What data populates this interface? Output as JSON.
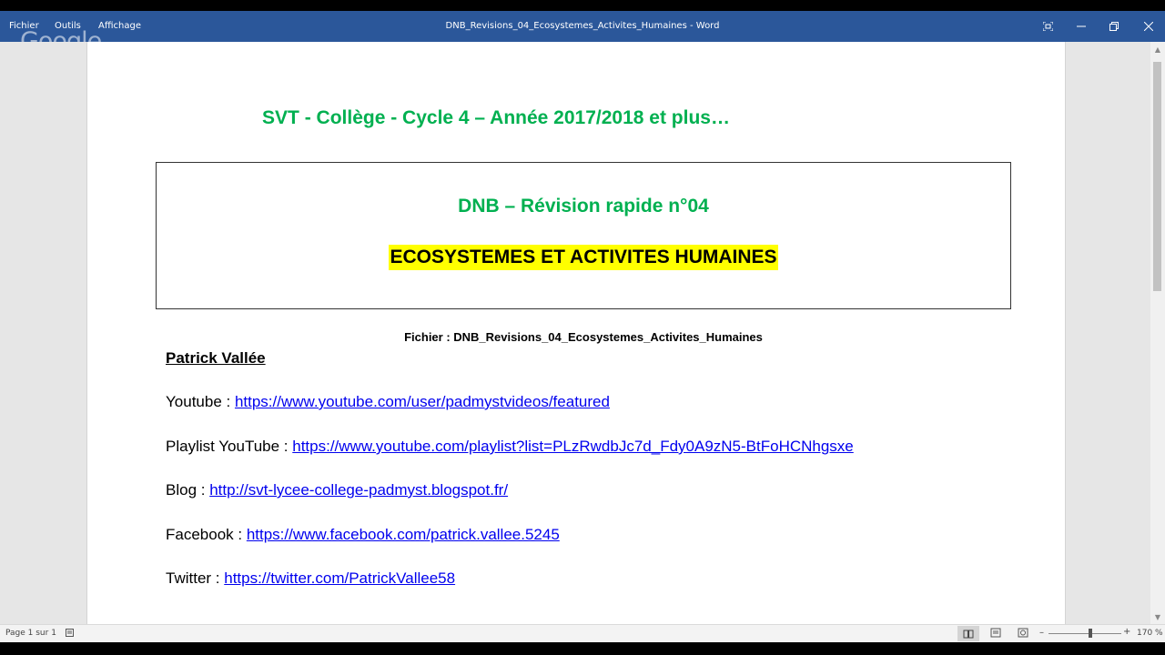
{
  "titlebar": {
    "menus": [
      "Fichier",
      "Outils",
      "Affichage"
    ],
    "title": "DNB_Revisions_04_Ecosystemes_Activites_Humaines  -  Word",
    "watermark": "Google"
  },
  "document": {
    "title": "SVT - Collège - Cycle 4 – Année 2017/2018 et plus…",
    "box": {
      "subtitle": "DNB – Révision rapide n°04",
      "heading": "ECOSYSTEMES ET ACTIVITES HUMAINES"
    },
    "file_line": "Fichier : DNB_Revisions_04_Ecosystemes_Activites_Humaines",
    "author": "Patrick Vallée",
    "links": [
      {
        "label": "Youtube : ",
        "url": "https://www.youtube.com/user/padmystvideos/featured"
      },
      {
        "label": "Playlist YouTube : ",
        "url": "https://www.youtube.com/playlist?list=PLzRwdbJc7d_Fdy0A9zN5-BtFoHCNhgsxe"
      },
      {
        "label": "Blog : ",
        "url": "http://svt-lycee-college-padmyst.blogspot.fr/"
      },
      {
        "label": "Facebook : ",
        "url": "https://www.facebook.com/patrick.vallee.5245"
      },
      {
        "label": "Twitter : ",
        "url": "https://twitter.com/PatrickVallee58"
      }
    ]
  },
  "statusbar": {
    "page": "Page 1 sur 1",
    "zoom_minus": "–",
    "zoom_plus": "+",
    "zoom": "170 %",
    "zoom_level_fraction": 0.55
  },
  "colors": {
    "titlebar": "#2b579a",
    "green_heading": "#00b050",
    "highlight": "#ffff00",
    "link": "#0000ee"
  },
  "icons": [
    "focus-mode-icon",
    "minimize-icon",
    "restore-icon",
    "close-icon",
    "read-mode-icon",
    "print-layout-icon",
    "web-layout-icon",
    "page-doc-icon"
  ]
}
